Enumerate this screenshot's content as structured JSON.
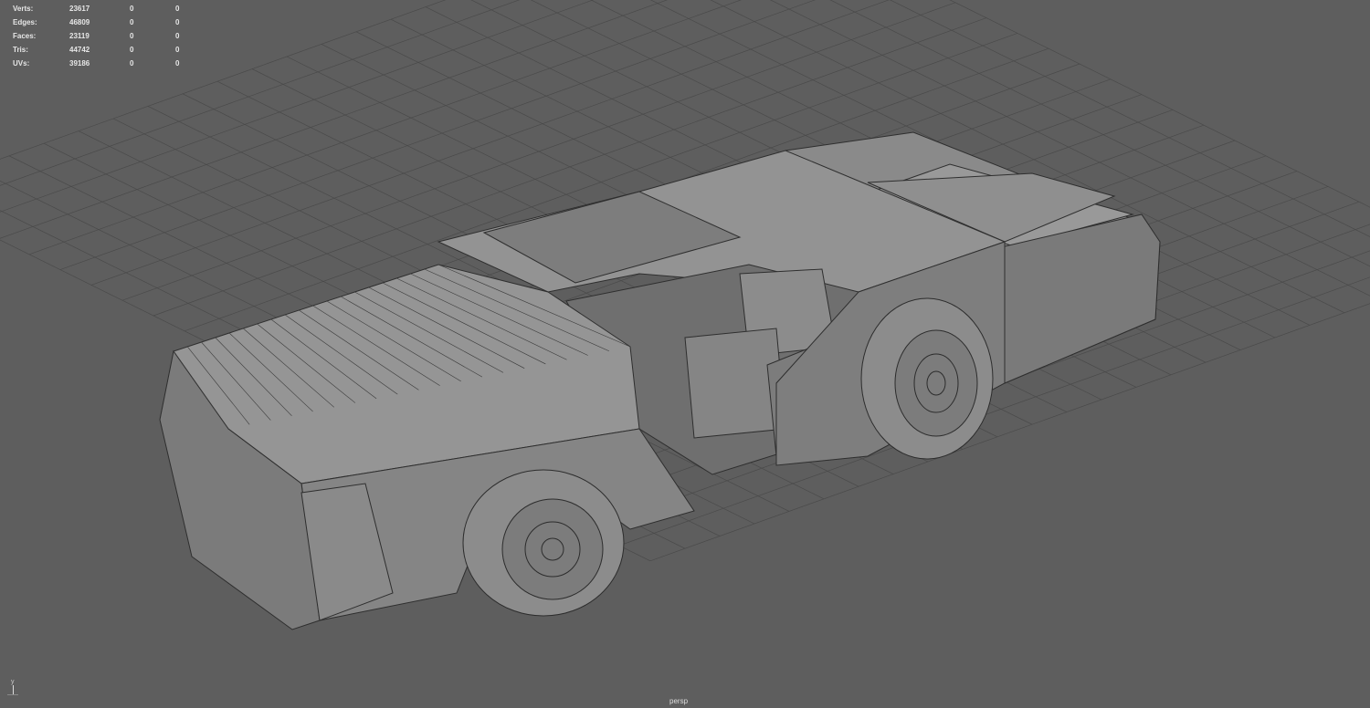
{
  "hud": {
    "rows": [
      {
        "label": "Verts:",
        "value": "23617",
        "c1": "0",
        "c2": "0"
      },
      {
        "label": "Edges:",
        "value": "46809",
        "c1": "0",
        "c2": "0"
      },
      {
        "label": "Faces:",
        "value": "23119",
        "c1": "0",
        "c2": "0"
      },
      {
        "label": "Tris:",
        "value": "44742",
        "c1": "0",
        "c2": "0"
      },
      {
        "label": "UVs:",
        "value": "39186",
        "c1": "0",
        "c2": "0"
      }
    ]
  },
  "camera_label": "persp",
  "axis_label": "y"
}
